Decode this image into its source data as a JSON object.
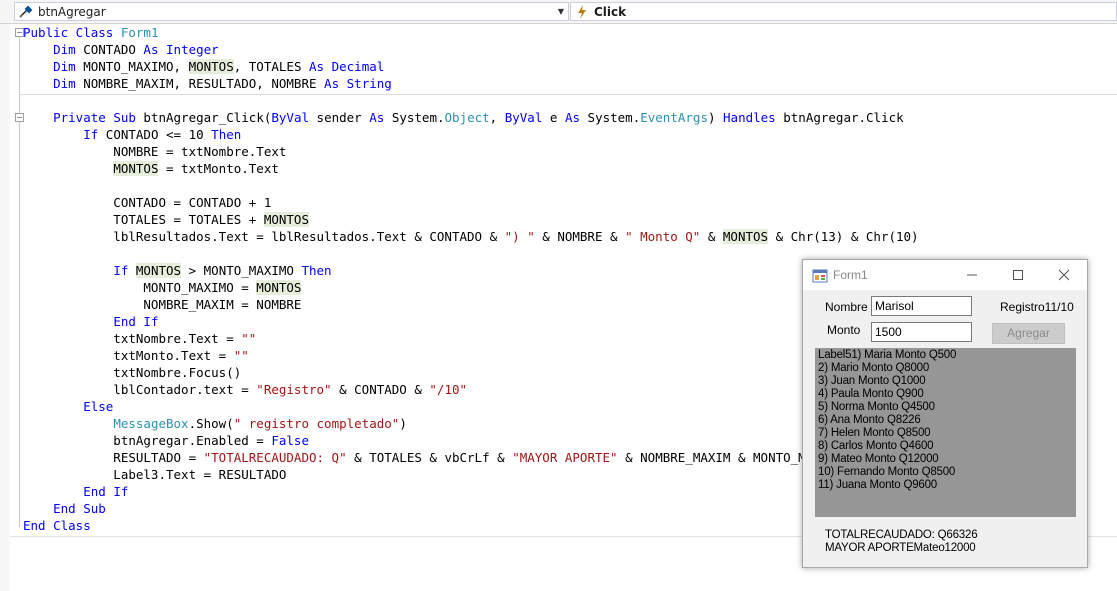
{
  "navbar": {
    "object_selector": "btnAgregar",
    "event_selector": "Click",
    "object_icon": "class-member-icon",
    "event_icon": "event-bolt-icon"
  },
  "code": {
    "lines": [
      [
        {
          "t": "Public Class ",
          "c": "kw"
        },
        {
          "t": "Form1",
          "c": "ty"
        }
      ],
      [
        {
          "t": "    "
        },
        {
          "t": "Dim",
          "c": "kw"
        },
        {
          "t": " CONTADO "
        },
        {
          "t": "As",
          "c": "kw"
        },
        {
          "t": " "
        },
        {
          "t": "Integer",
          "c": "kw"
        }
      ],
      [
        {
          "t": "    "
        },
        {
          "t": "Dim",
          "c": "kw"
        },
        {
          "t": " MONTO_MAXIMO, "
        },
        {
          "t": "MONTOS",
          "c": "hl"
        },
        {
          "t": ", TOTALES "
        },
        {
          "t": "As",
          "c": "kw"
        },
        {
          "t": " "
        },
        {
          "t": "Decimal",
          "c": "kw"
        }
      ],
      [
        {
          "t": "    "
        },
        {
          "t": "Dim",
          "c": "kw"
        },
        {
          "t": " NOMBRE_MAXIM, RESULTADO, NOMBRE "
        },
        {
          "t": "As",
          "c": "kw"
        },
        {
          "t": " "
        },
        {
          "t": "String",
          "c": "kw"
        }
      ],
      [],
      [
        {
          "t": "    "
        },
        {
          "t": "Private Sub",
          "c": "kw"
        },
        {
          "t": " btnAgregar_Click("
        },
        {
          "t": "ByVal",
          "c": "kw"
        },
        {
          "t": " sender "
        },
        {
          "t": "As",
          "c": "kw"
        },
        {
          "t": " System."
        },
        {
          "t": "Object",
          "c": "ty"
        },
        {
          "t": ", "
        },
        {
          "t": "ByVal",
          "c": "kw"
        },
        {
          "t": " e "
        },
        {
          "t": "As",
          "c": "kw"
        },
        {
          "t": " System."
        },
        {
          "t": "EventArgs",
          "c": "ty"
        },
        {
          "t": ") "
        },
        {
          "t": "Handles",
          "c": "kw"
        },
        {
          "t": " btnAgregar.Click"
        }
      ],
      [
        {
          "t": "        "
        },
        {
          "t": "If",
          "c": "kw"
        },
        {
          "t": " CONTADO <= 10 "
        },
        {
          "t": "Then",
          "c": "kw"
        }
      ],
      [
        {
          "t": "            NOMBRE = txtNombre.Text"
        }
      ],
      [
        {
          "t": "            "
        },
        {
          "t": "MONTOS",
          "c": "hl"
        },
        {
          "t": " = txtMonto.Text"
        }
      ],
      [],
      [
        {
          "t": "            CONTADO = CONTADO + 1"
        }
      ],
      [
        {
          "t": "            TOTALES = TOTALES + "
        },
        {
          "t": "MONTOS",
          "c": "hl"
        }
      ],
      [
        {
          "t": "            lblResultados.Text = lblResultados.Text & CONTADO & "
        },
        {
          "t": "\") \"",
          "c": "st"
        },
        {
          "t": " & NOMBRE & "
        },
        {
          "t": "\" Monto Q\"",
          "c": "st"
        },
        {
          "t": " & "
        },
        {
          "t": "MONTOS",
          "c": "hl"
        },
        {
          "t": " & Chr(13) & Chr(10)"
        }
      ],
      [],
      [
        {
          "t": "            "
        },
        {
          "t": "If",
          "c": "kw"
        },
        {
          "t": " "
        },
        {
          "t": "MONTOS",
          "c": "hl"
        },
        {
          "t": " > MONTO_MAXIMO "
        },
        {
          "t": "Then",
          "c": "kw"
        }
      ],
      [
        {
          "t": "                MONTO_MAXIMO = "
        },
        {
          "t": "MONTOS",
          "c": "hl"
        }
      ],
      [
        {
          "t": "                NOMBRE_MAXIM = NOMBRE"
        }
      ],
      [
        {
          "t": "            "
        },
        {
          "t": "End If",
          "c": "kw"
        }
      ],
      [
        {
          "t": "            txtNombre.Text = "
        },
        {
          "t": "\"\"",
          "c": "st"
        }
      ],
      [
        {
          "t": "            txtMonto.Text = "
        },
        {
          "t": "\"\"",
          "c": "st"
        }
      ],
      [
        {
          "t": "            txtNombre.Focus()"
        }
      ],
      [
        {
          "t": "            lblContador.text = "
        },
        {
          "t": "\"Registro\"",
          "c": "st"
        },
        {
          "t": " & CONTADO & "
        },
        {
          "t": "\"/10\"",
          "c": "st"
        }
      ],
      [
        {
          "t": "        "
        },
        {
          "t": "Else",
          "c": "kw"
        }
      ],
      [
        {
          "t": "            "
        },
        {
          "t": "MessageBox",
          "c": "ty"
        },
        {
          "t": ".Show("
        },
        {
          "t": "\" registro completado\"",
          "c": "st"
        },
        {
          "t": ")"
        }
      ],
      [
        {
          "t": "            btnAgregar.Enabled = "
        },
        {
          "t": "False",
          "c": "kw"
        }
      ],
      [
        {
          "t": "            RESULTADO = "
        },
        {
          "t": "\"TOTALRECAUDADO: Q\"",
          "c": "st"
        },
        {
          "t": " & TOTALES & vbCrLf & "
        },
        {
          "t": "\"MAYOR APORTE\"",
          "c": "st"
        },
        {
          "t": " & NOMBRE_MAXIM & MONTO_M"
        }
      ],
      [
        {
          "t": "            Label3.Text = RESULTADO"
        }
      ],
      [
        {
          "t": "        "
        },
        {
          "t": "End If",
          "c": "kw"
        }
      ],
      [
        {
          "t": "    "
        },
        {
          "t": "End Sub",
          "c": "kw"
        }
      ],
      [
        {
          "t": "End Class",
          "c": "kw"
        }
      ]
    ]
  },
  "colors": {
    "keyword": "#0000ff",
    "type": "#2b91af",
    "string": "#a31515",
    "highlight": "#e5eddb",
    "results_bg": "#969696"
  },
  "form": {
    "title": "Form1",
    "nombre_label": "Nombre",
    "nombre_value": "Marisol",
    "monto_label": "Monto",
    "monto_value": "1500",
    "contador_text": "Registro11/10",
    "agregar_label": "Agregar",
    "agregar_enabled": false,
    "results": [
      "Label51) Maria Monto Q500",
      "2) Mario Monto Q8000",
      "3) Juan Monto Q1000",
      "4) Paula Monto Q900",
      "5) Norma Monto Q4500",
      "6) Ana Monto Q8226",
      "7) Helen Monto Q8500",
      "8) Carlos Monto Q4600",
      "9) Mateo Monto Q12000",
      "10) Fernando Monto Q8500",
      "11) Juana Monto Q9600"
    ],
    "summary_total": "TOTALRECAUDADO: Q66326",
    "summary_max": "MAYOR APORTEMateo12000"
  }
}
